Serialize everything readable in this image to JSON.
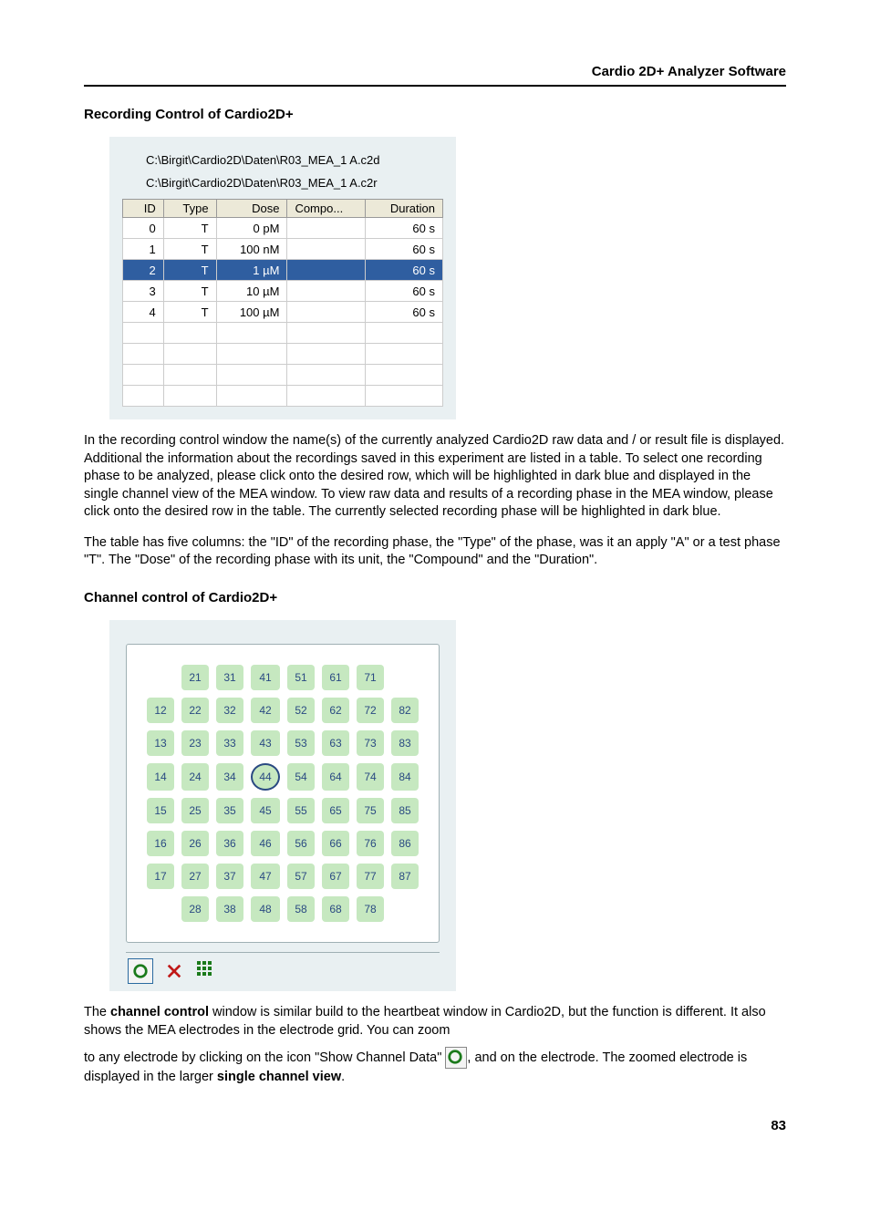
{
  "header_title": "Cardio 2D+ Analyzer Software",
  "page_number": "83",
  "sec1": {
    "title": "Recording Control of Cardio2D+",
    "path1": "C:\\Birgit\\Cardio2D\\Daten\\R03_MEA_1 A.c2d",
    "path2": "C:\\Birgit\\Cardio2D\\Daten\\R03_MEA_1 A.c2r",
    "headers": {
      "id": "ID",
      "type": "Type",
      "dose": "Dose",
      "compo": "Compo...",
      "duration": "Duration"
    },
    "rows": [
      {
        "id": "0",
        "type": "T",
        "dose": "0 pM",
        "compo": "",
        "duration": "60 s"
      },
      {
        "id": "1",
        "type": "T",
        "dose": "100 nM",
        "compo": "",
        "duration": "60 s"
      },
      {
        "id": "2",
        "type": "T",
        "dose": "1 µM",
        "compo": "",
        "duration": "60 s"
      },
      {
        "id": "3",
        "type": "T",
        "dose": "10 µM",
        "compo": "",
        "duration": "60 s"
      },
      {
        "id": "4",
        "type": "T",
        "dose": "100 µM",
        "compo": "",
        "duration": "60 s"
      }
    ],
    "para1": "In the recording control window the name(s) of the currently analyzed Cardio2D raw data and / or result file is displayed. Additional the information about the recordings saved in this experiment are listed in a table. To select one recording phase to be analyzed, please click onto the desired row, which will be highlighted in dark blue and displayed in the single channel view of the MEA window. To view raw data and results of a recording phase in the MEA window, please click onto the desired row in the table. The currently selected recording phase will be highlighted in dark blue.",
    "para2": "The table has five columns: the \"ID\" of the recording phase, the \"Type\" of the phase, was it an apply \"A\" or a test phase \"T\". The \"Dose\" of the recording phase with its unit, the \"Compound\" and the \"Duration\"."
  },
  "sec2": {
    "title": "Channel control of Cardio2D+",
    "reference_electrode": "44",
    "grid": [
      [
        "",
        "21",
        "31",
        "41",
        "51",
        "61",
        "71",
        ""
      ],
      [
        "12",
        "22",
        "32",
        "42",
        "52",
        "62",
        "72",
        "82"
      ],
      [
        "13",
        "23",
        "33",
        "43",
        "53",
        "63",
        "73",
        "83"
      ],
      [
        "14",
        "24",
        "34",
        "44",
        "54",
        "64",
        "74",
        "84"
      ],
      [
        "15",
        "25",
        "35",
        "45",
        "55",
        "65",
        "75",
        "85"
      ],
      [
        "16",
        "26",
        "36",
        "46",
        "56",
        "66",
        "76",
        "86"
      ],
      [
        "17",
        "27",
        "37",
        "47",
        "57",
        "67",
        "77",
        "87"
      ],
      [
        "",
        "28",
        "38",
        "48",
        "58",
        "68",
        "78",
        ""
      ]
    ],
    "para_parts": {
      "p1a": "The ",
      "p1b": "channel control",
      "p1c": " window is similar build to the heartbeat window in Cardio2D, but the function is different. It also shows the MEA electrodes in the electrode grid. You can zoom",
      "p2a": "to any electrode by clicking on the icon \"Show Channel Data\" ",
      "p2b": ", and on the electrode. The zoomed electrode is displayed in the larger ",
      "p2c": "single channel view",
      "p2d": "."
    },
    "toolbar": {
      "show_channel_data": "show-channel-data-icon",
      "deselect": "deselect-icon",
      "grid_view": "grid-view-icon"
    }
  }
}
